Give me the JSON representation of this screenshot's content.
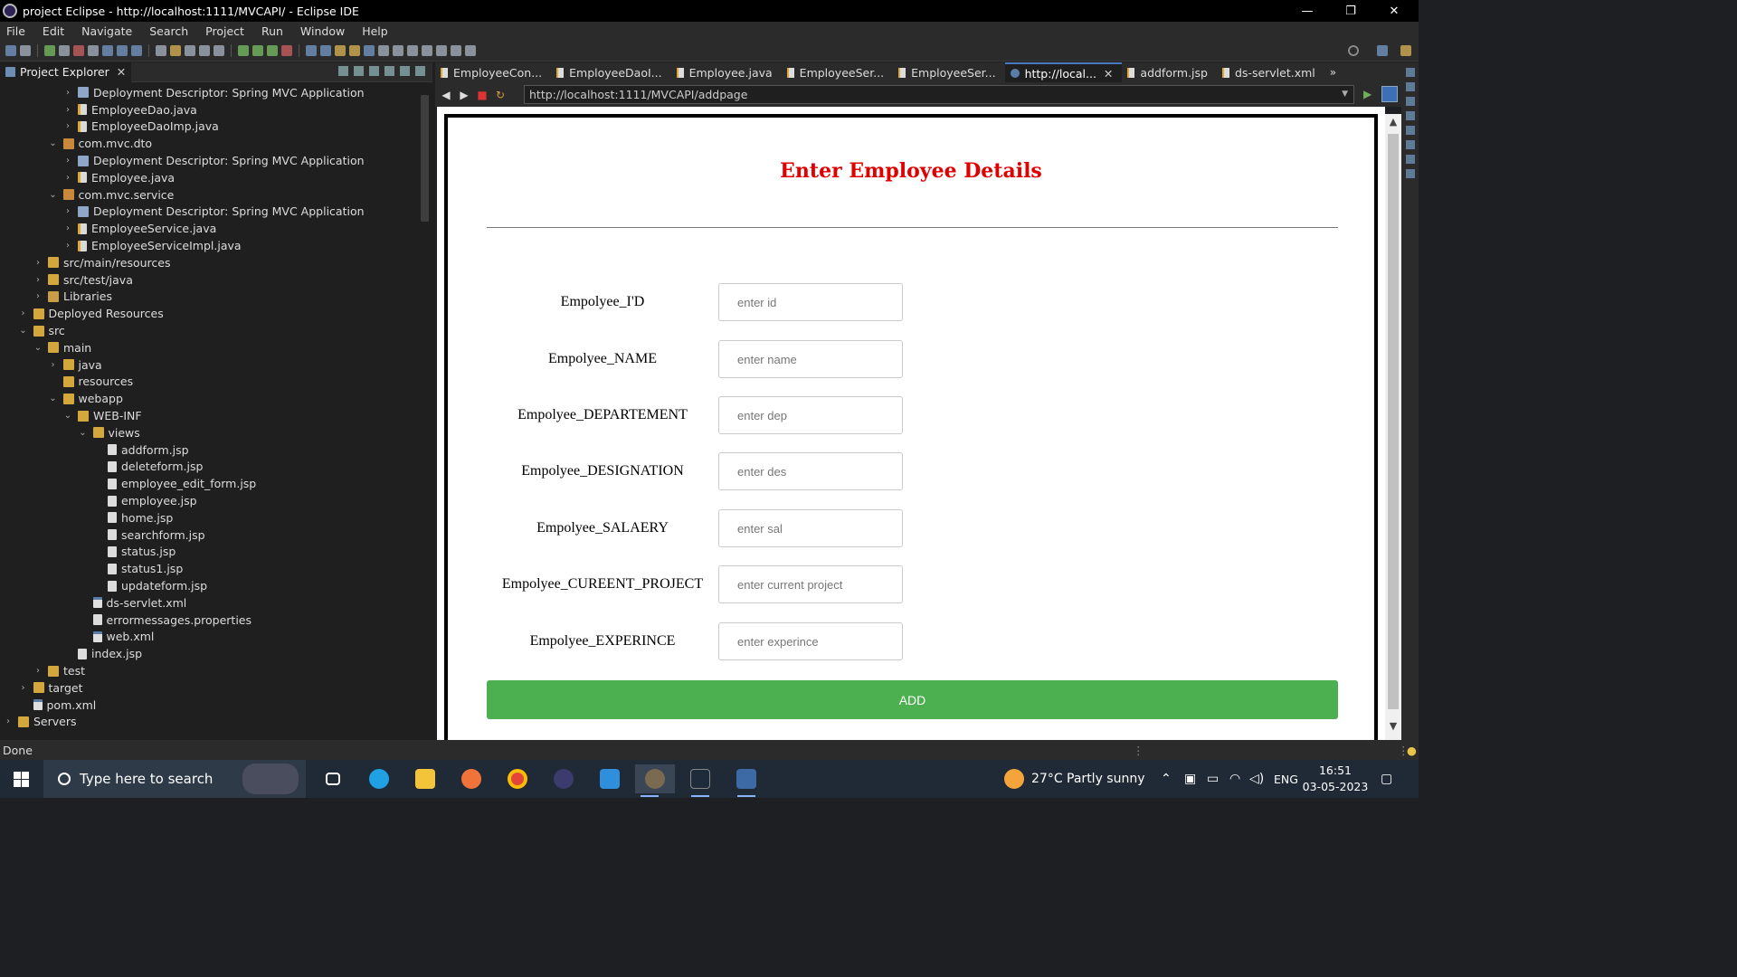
{
  "window": {
    "title": "project Eclipse - http://localhost:1111/MVCAPI/ - Eclipse IDE",
    "minimize": "—",
    "restore": "❐",
    "close": "✕"
  },
  "menu": [
    "File",
    "Edit",
    "Navigate",
    "Search",
    "Project",
    "Run",
    "Window",
    "Help"
  ],
  "project_explorer": {
    "tab_label": "Project Explorer",
    "tree": [
      {
        "label": "Deployment Descriptor: Spring MVC Application",
        "indent": 4,
        "twisty": "›",
        "icon": "dd"
      },
      {
        "label": "EmployeeDao.java",
        "indent": 4,
        "twisty": "›",
        "icon": "java"
      },
      {
        "label": "EmployeeDaoImp.java",
        "indent": 4,
        "twisty": "›",
        "icon": "java"
      },
      {
        "label": "com.mvc.dto",
        "indent": 3,
        "twisty": "⌄",
        "icon": "pkg"
      },
      {
        "label": "Deployment Descriptor: Spring MVC Application",
        "indent": 4,
        "twisty": "›",
        "icon": "dd"
      },
      {
        "label": "Employee.java",
        "indent": 4,
        "twisty": "›",
        "icon": "java"
      },
      {
        "label": "com.mvc.service",
        "indent": 3,
        "twisty": "⌄",
        "icon": "pkg"
      },
      {
        "label": "Deployment Descriptor: Spring MVC Application",
        "indent": 4,
        "twisty": "›",
        "icon": "dd"
      },
      {
        "label": "EmployeeService.java",
        "indent": 4,
        "twisty": "›",
        "icon": "java"
      },
      {
        "label": "EmployeeServiceImpl.java",
        "indent": 4,
        "twisty": "›",
        "icon": "java"
      },
      {
        "label": "src/main/resources",
        "indent": 2,
        "twisty": "›",
        "icon": "folder"
      },
      {
        "label": "src/test/java",
        "indent": 2,
        "twisty": "›",
        "icon": "folder"
      },
      {
        "label": "Libraries",
        "indent": 2,
        "twisty": "›",
        "icon": "lib"
      },
      {
        "label": "Deployed Resources",
        "indent": 1,
        "twisty": "›",
        "icon": "folder"
      },
      {
        "label": "src",
        "indent": 1,
        "twisty": "⌄",
        "icon": "folder"
      },
      {
        "label": "main",
        "indent": 2,
        "twisty": "⌄",
        "icon": "folder"
      },
      {
        "label": "java",
        "indent": 3,
        "twisty": "›",
        "icon": "folder"
      },
      {
        "label": "resources",
        "indent": 3,
        "twisty": "",
        "icon": "folder"
      },
      {
        "label": "webapp",
        "indent": 3,
        "twisty": "⌄",
        "icon": "folder"
      },
      {
        "label": "WEB-INF",
        "indent": 4,
        "twisty": "⌄",
        "icon": "folder"
      },
      {
        "label": "views",
        "indent": 5,
        "twisty": "⌄",
        "icon": "folder"
      },
      {
        "label": "addform.jsp",
        "indent": 6,
        "twisty": "",
        "icon": "file"
      },
      {
        "label": "deleteform.jsp",
        "indent": 6,
        "twisty": "",
        "icon": "file"
      },
      {
        "label": "employee_edit_form.jsp",
        "indent": 6,
        "twisty": "",
        "icon": "file"
      },
      {
        "label": "employee.jsp",
        "indent": 6,
        "twisty": "",
        "icon": "file"
      },
      {
        "label": "home.jsp",
        "indent": 6,
        "twisty": "",
        "icon": "file"
      },
      {
        "label": "searchform.jsp",
        "indent": 6,
        "twisty": "",
        "icon": "file"
      },
      {
        "label": "status.jsp",
        "indent": 6,
        "twisty": "",
        "icon": "file"
      },
      {
        "label": "status1.jsp",
        "indent": 6,
        "twisty": "",
        "icon": "file"
      },
      {
        "label": "updateform.jsp",
        "indent": 6,
        "twisty": "",
        "icon": "file"
      },
      {
        "label": "ds-servlet.xml",
        "indent": 5,
        "twisty": "",
        "icon": "xml"
      },
      {
        "label": "errormessages.properties",
        "indent": 5,
        "twisty": "",
        "icon": "file"
      },
      {
        "label": "web.xml",
        "indent": 5,
        "twisty": "",
        "icon": "xml"
      },
      {
        "label": "index.jsp",
        "indent": 4,
        "twisty": "",
        "icon": "file"
      },
      {
        "label": "test",
        "indent": 2,
        "twisty": "›",
        "icon": "folder"
      },
      {
        "label": "target",
        "indent": 1,
        "twisty": "›",
        "icon": "folder"
      },
      {
        "label": "pom.xml",
        "indent": 1,
        "twisty": "",
        "icon": "xml"
      },
      {
        "label": "Servers",
        "indent": 0,
        "twisty": "›",
        "icon": "folder"
      }
    ]
  },
  "editor_tabs": [
    {
      "label": "EmployeeCon...",
      "active": false
    },
    {
      "label": "EmployeeDaoI...",
      "active": false
    },
    {
      "label": "Employee.java",
      "active": false
    },
    {
      "label": "EmployeeSer...",
      "active": false
    },
    {
      "label": "EmployeeSer...",
      "active": false
    },
    {
      "label": "http://local...",
      "active": true
    },
    {
      "label": "addform.jsp",
      "active": false
    },
    {
      "label": "ds-servlet.xml",
      "active": false
    }
  ],
  "overflow_label": "»",
  "browser": {
    "url": "http://localhost:1111/MVCAPI/addpage"
  },
  "form": {
    "heading": "Enter Employee Details",
    "fields": [
      {
        "label": "Empolyee_I'D",
        "placeholder": "enter id"
      },
      {
        "label": "Empolyee_NAME",
        "placeholder": "enter name"
      },
      {
        "label": "Empolyee_DEPARTEMENT",
        "placeholder": "enter dep"
      },
      {
        "label": "Empolyee_DESIGNATION",
        "placeholder": "enter des"
      },
      {
        "label": "Empolyee_SALAERY",
        "placeholder": "enter sal"
      },
      {
        "label": "Empolyee_CUREENT_PROJECT",
        "placeholder": "enter current project"
      },
      {
        "label": "Empolyee_EXPERINCE",
        "placeholder": "enter experince"
      }
    ],
    "submit_label": "ADD",
    "accent_color": "#4caf50",
    "heading_color": "#e00000"
  },
  "status": {
    "text": "Done"
  },
  "taskbar": {
    "search_placeholder": "Type here to search",
    "weather": "27°C  Partly sunny",
    "language": "ENG",
    "time": "16:51",
    "date": "03-05-2023"
  }
}
